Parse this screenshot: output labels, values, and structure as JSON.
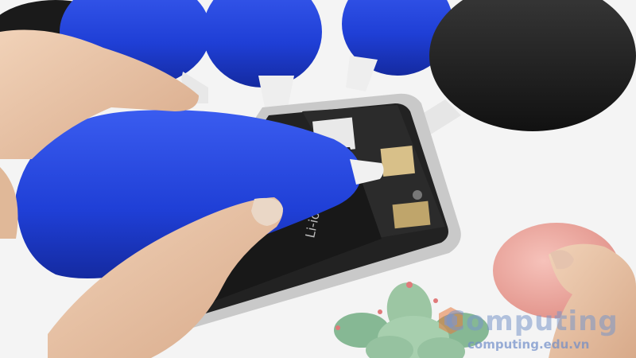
{
  "scene": {
    "description_alt": "",
    "battery_label": "Li-ion",
    "watermark": {
      "title": "Computing",
      "url": "computing.edu.vn"
    },
    "colors": {
      "blue_bulb": "#1f3fd6",
      "black_bulb": "#1c1c1c",
      "pink_bulb": "#f0a7a0",
      "phone_frame": "#c9c9c9",
      "background": "#f4f4f4",
      "succulent": "#8fbf9a"
    }
  }
}
